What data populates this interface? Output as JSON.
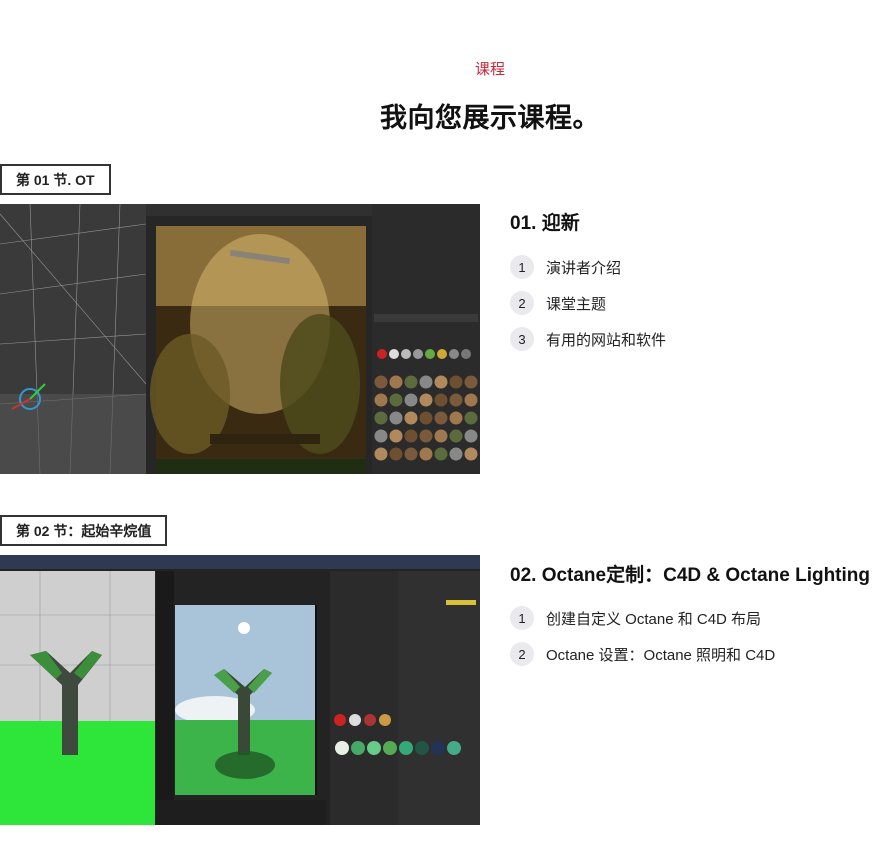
{
  "header": {
    "eyebrow": "课程",
    "title": "我向您展示课程。"
  },
  "sections": [
    {
      "tag": "第 01 节. OT",
      "lesson_title": "01. 迎新",
      "items": [
        {
          "num": "1",
          "label": "演讲者介绍"
        },
        {
          "num": "2",
          "label": "课堂主题"
        },
        {
          "num": "3",
          "label": "有用的网站和软件"
        }
      ],
      "image": "c4d-octane-jungle-render-screenshot"
    },
    {
      "tag": "第 02 节：起始辛烷值",
      "lesson_title": "02. Octane定制：C4D & Octane Lighting",
      "items": [
        {
          "num": "1",
          "label": "创建自定义 Octane 和 C4D 布局"
        },
        {
          "num": "2",
          "label": "Octane 设置：Octane 照明和 C4D"
        }
      ],
      "image": "c4d-octane-y-logo-render-screenshot"
    }
  ],
  "colors": {
    "accent": "#c8283a",
    "text": "#111111",
    "badge_bg": "#e9e9ee",
    "green_floor": "#2ee63a"
  }
}
